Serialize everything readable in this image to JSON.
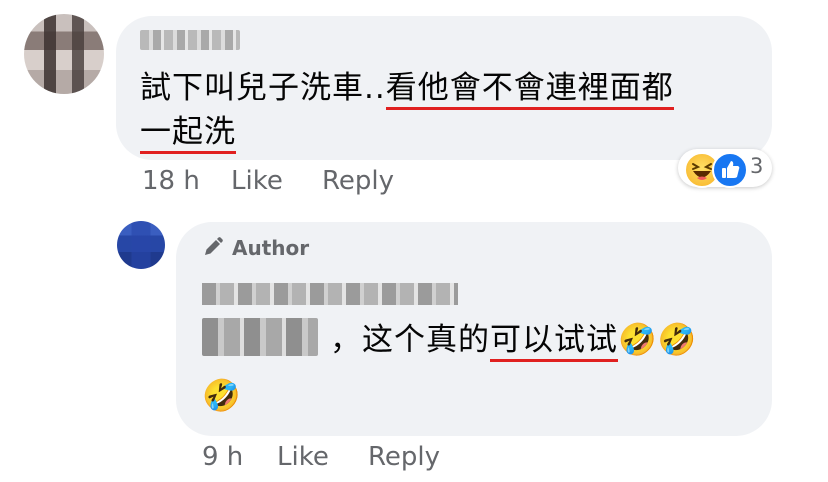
{
  "comment": {
    "text_line1": "試下叫兒子洗車..",
    "text_line1_underlined": "看他會不會連裡面都",
    "text_line2_underlined": "一起洗",
    "time": "18 h",
    "like_label": "Like",
    "reply_label": "Reply",
    "reaction_count": "3",
    "reaction_icons": [
      "haha-icon",
      "like-icon"
    ]
  },
  "reply": {
    "author_badge": "Author",
    "text_prefix": "，这个真的",
    "text_underlined": "可以试试",
    "emoji": "🤣🤣",
    "emoji_line2": "🤣",
    "time": "9 h",
    "like_label": "Like",
    "reply_label": "Reply"
  },
  "colors": {
    "bubble": "#f0f2f5",
    "meta_text": "#65676b",
    "underline": "#e02020",
    "like_blue": "#1877f2"
  }
}
